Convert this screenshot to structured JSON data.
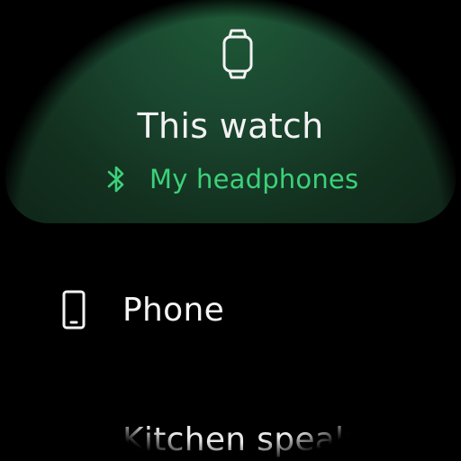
{
  "header": {
    "icon": "watch-icon",
    "title": "This watch",
    "output_device": {
      "icon": "bluetooth-icon",
      "label": "My headphones"
    }
  },
  "list": {
    "items": [
      {
        "icon": "phone-icon",
        "label": "Phone"
      },
      {
        "icon": "",
        "label": "Kitchen speaker"
      }
    ]
  },
  "colors": {
    "accent": "#3cd17a",
    "background": "#000000",
    "card": "#1a4730"
  }
}
